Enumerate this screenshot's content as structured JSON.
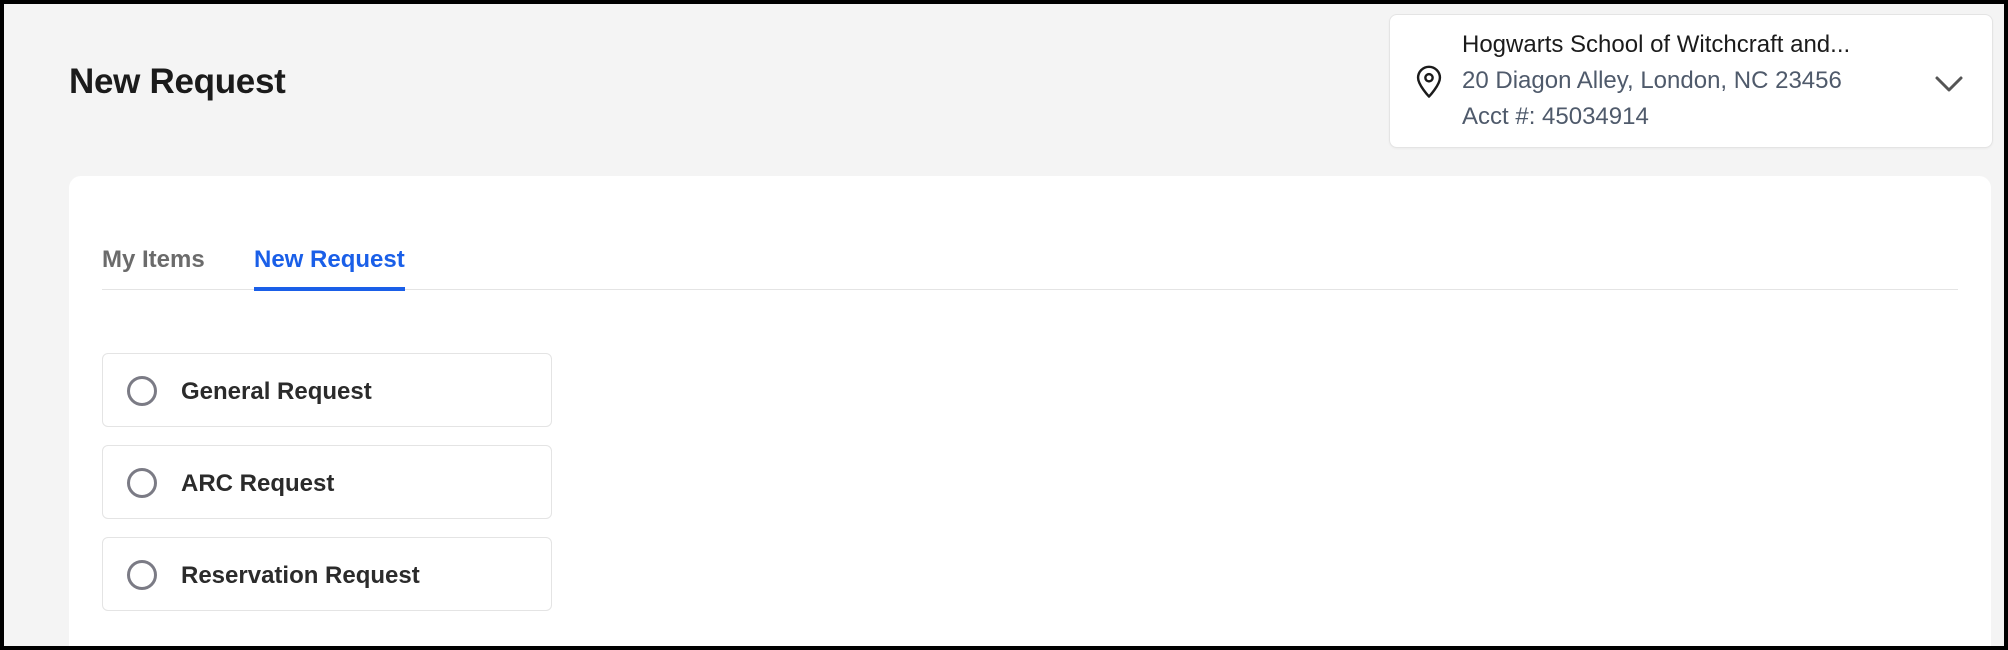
{
  "page": {
    "title": "New Request"
  },
  "account": {
    "name": "Hogwarts School of Witchcraft and...",
    "address": "20 Diagon Alley, London, NC 23456",
    "account_number": "Acct #: 45034914",
    "location_icon": "map-pin-icon",
    "expand_icon": "chevron-down-icon"
  },
  "tabs": [
    {
      "label": "My Items",
      "active": false
    },
    {
      "label": "New Request",
      "active": true
    }
  ],
  "request_options": [
    {
      "label": "General Request",
      "selected": false
    },
    {
      "label": "ARC Request",
      "selected": false
    },
    {
      "label": "Reservation Request",
      "selected": false
    }
  ],
  "colors": {
    "accent": "#1a5fe8",
    "background": "#f4f4f4",
    "surface": "#ffffff",
    "text_primary": "#1b1b1b",
    "text_secondary": "#4f5a6b",
    "tab_inactive": "#6b6b6b",
    "border": "#e4e4e4"
  }
}
